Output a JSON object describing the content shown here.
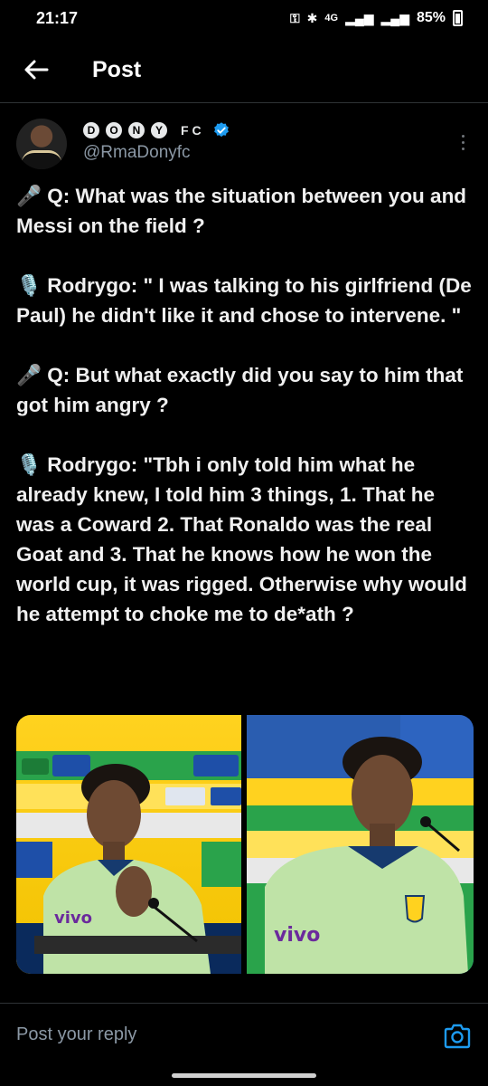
{
  "status_bar": {
    "time": "21:17",
    "network": "4G",
    "battery": "85%"
  },
  "app_bar": {
    "title": "Post",
    "back_icon": "arrow-left-icon"
  },
  "post": {
    "author": {
      "display_name_letters": [
        "D",
        "O",
        "N",
        "Y"
      ],
      "display_name_suffix": "F C",
      "verified": true,
      "handle": "@RmaDonyfc"
    },
    "paragraphs": [
      "🎤 Q: What was the situation between you and Messi on the field ?",
      "🎙️ Rodrygo: \" I was talking to his girlfriend (De Paul) he didn't like it and chose to intervene. \"",
      "🎤 Q: But what exactly did you say to him that got him angry ?",
      "🎙️ Rodrygo: \"Tbh i only told him what he already knew, I told him 3 things, 1. That he was a Coward 2. That Ronaldo was the real Goat and 3. That he knows how he won the world cup, it was rigged. Otherwise why would he attempt to choke me to de*ath ?"
    ],
    "media_count": 2
  },
  "reply": {
    "placeholder": "Post your reply",
    "camera_icon": "camera-icon"
  },
  "colors": {
    "background": "#000000",
    "accent": "#1d9bf0",
    "muted_text": "#8b98a5"
  }
}
